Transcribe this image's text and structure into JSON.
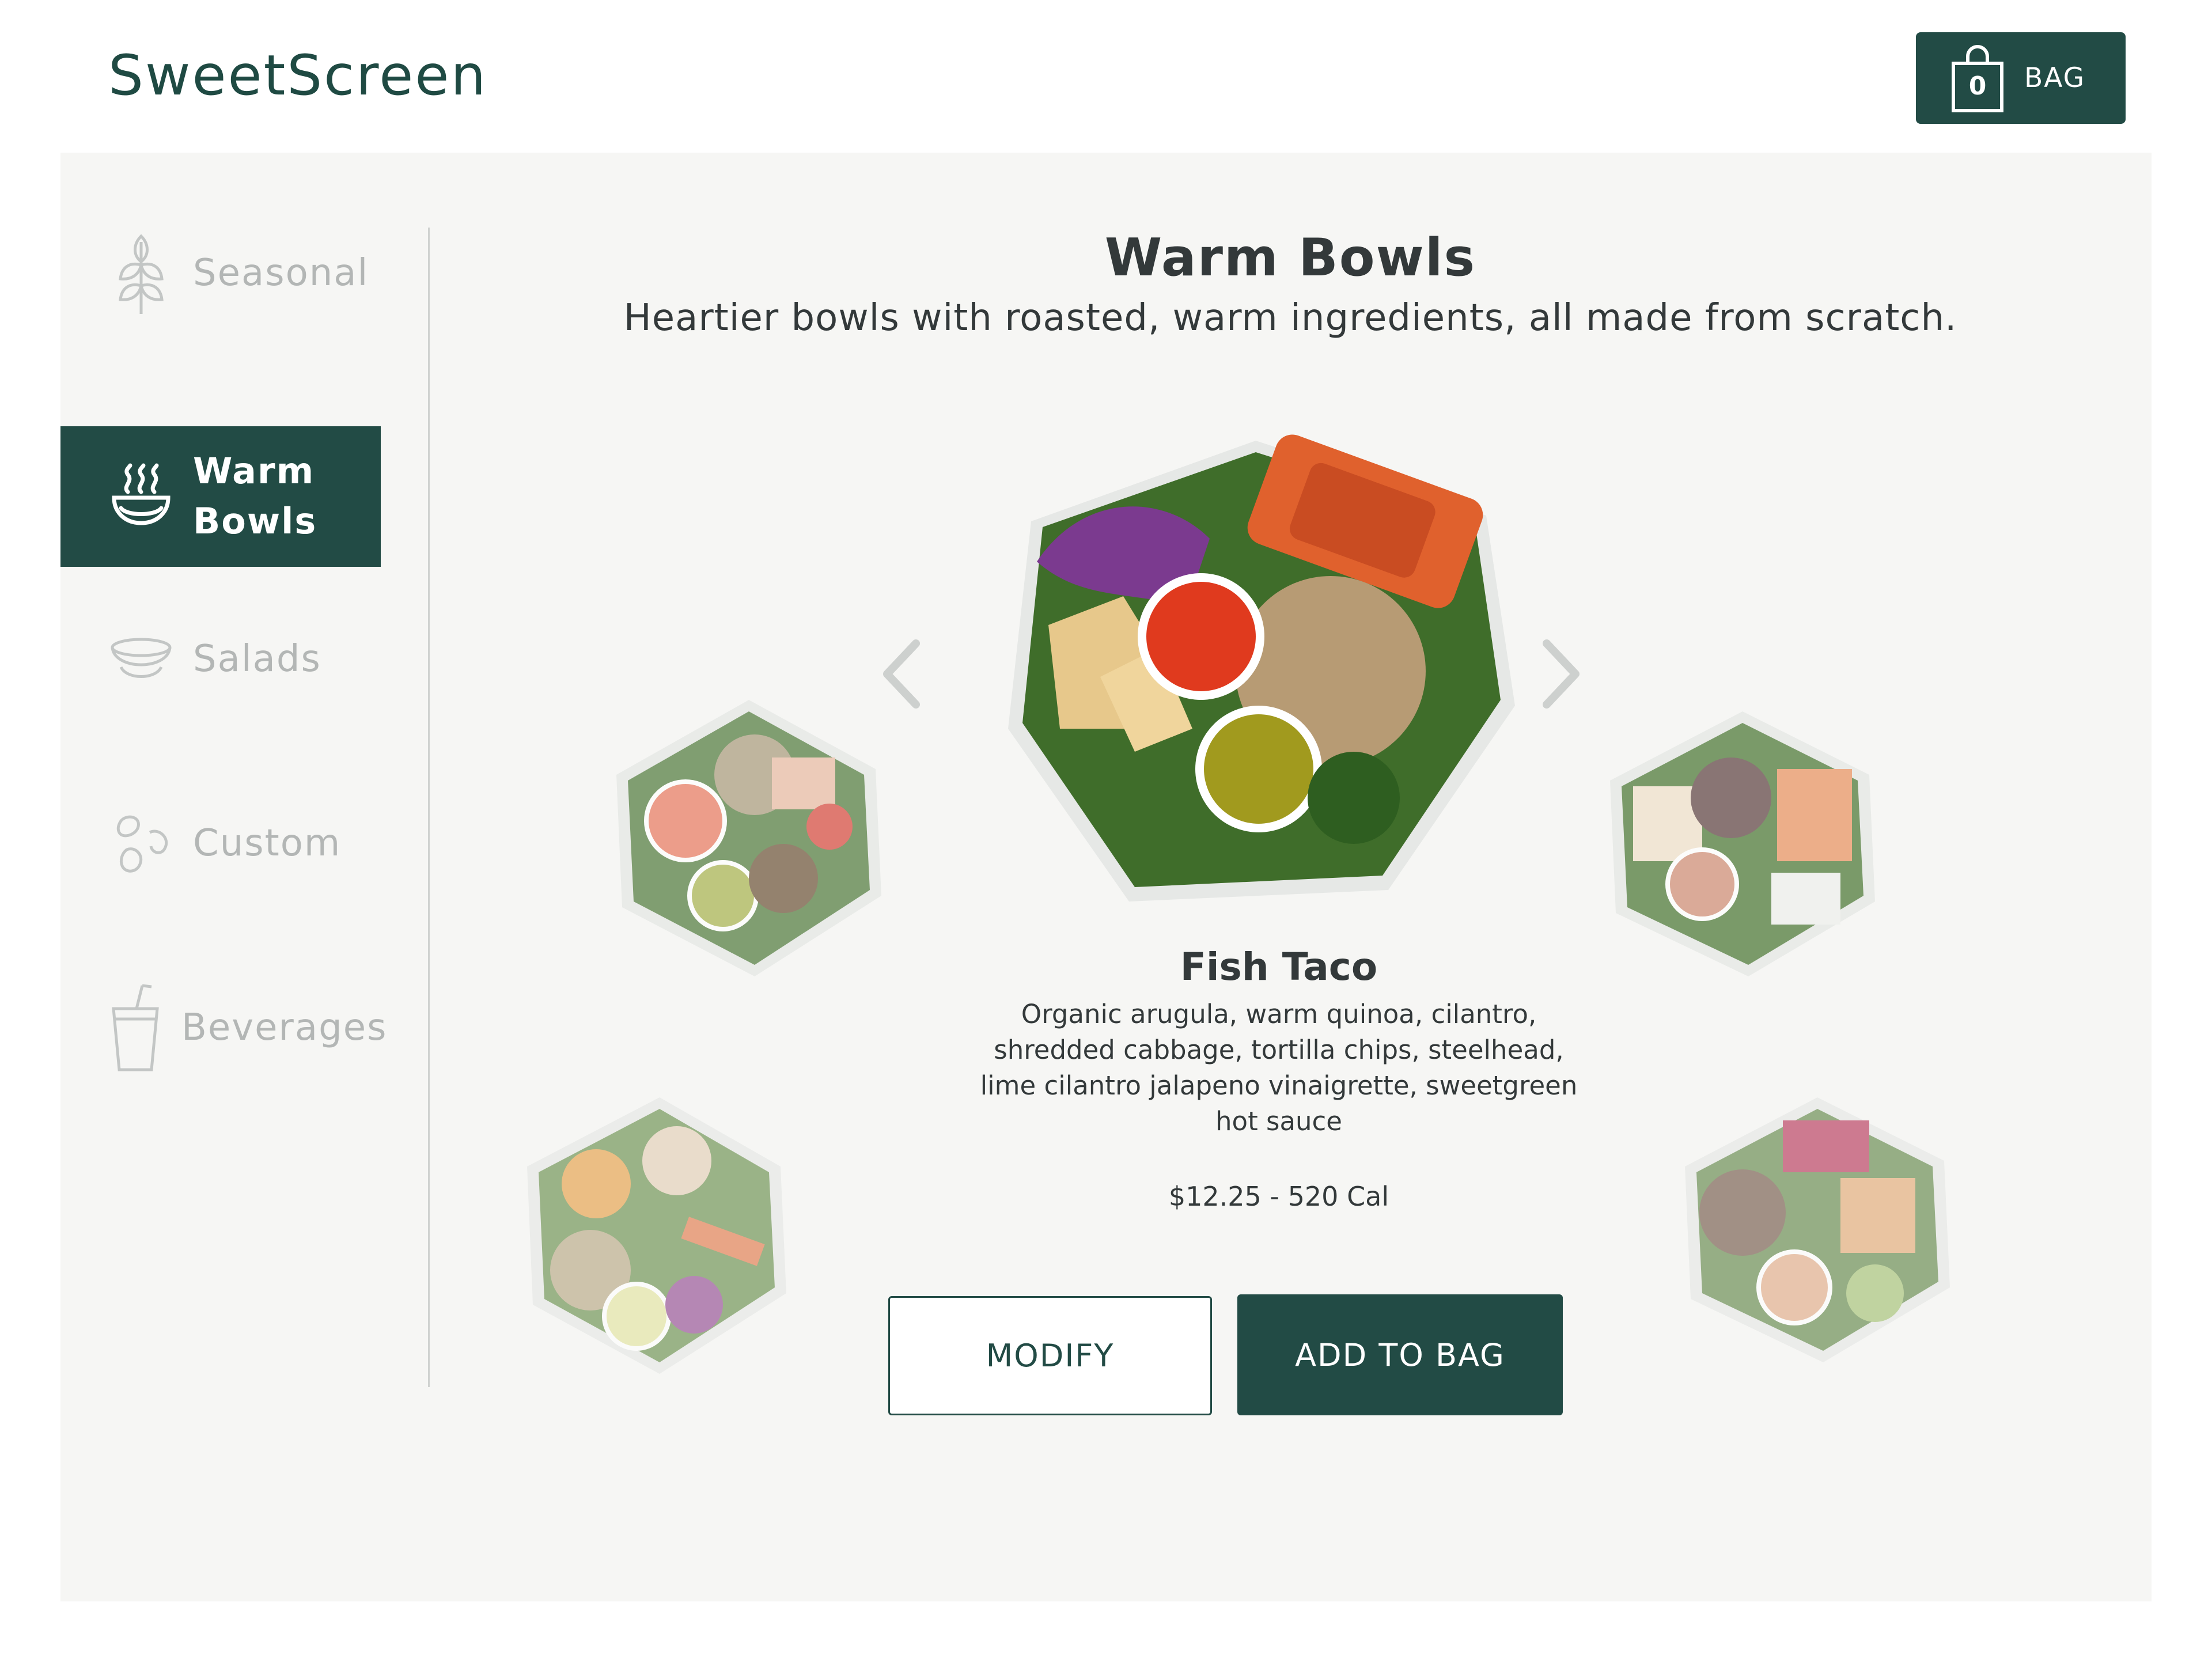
{
  "app": {
    "logo_text": "SweetScreen"
  },
  "header": {
    "bag_count": "0",
    "bag_label": "BAG",
    "bag_icon": "shopping-bag-icon"
  },
  "sidebar": {
    "items": [
      {
        "label": "Seasonal",
        "icon": "wheat-icon",
        "active": false
      },
      {
        "label": "Warm\nBowls",
        "icon": "steaming-bowl-icon",
        "active": true
      },
      {
        "label": "Salads",
        "icon": "salad-bowl-icon",
        "active": false
      },
      {
        "label": "Custom",
        "icon": "ingredients-icon",
        "active": false
      },
      {
        "label": "Beverages",
        "icon": "drink-cup-icon",
        "active": false
      }
    ]
  },
  "main": {
    "title": "Warm Bowls",
    "subtitle": "Heartier bowls with roasted, warm ingredients, all made from scratch.",
    "featured": {
      "name": "Fish Taco",
      "description": "Organic arugula, warm quinoa, cilantro, shredded cabbage, tortilla chips, steelhead, lime cilantro jalapeno vinaigrette, sweetgreen hot sauce",
      "price_cal": "$12.25 - 520 Cal"
    },
    "buttons": {
      "modify": "MODIFY",
      "add_to_bag": "ADD TO BAG"
    }
  },
  "colors": {
    "brand": "#224b45",
    "stage_bg": "#f6f6f4",
    "text": "#33393a",
    "muted": "#b3b6b5"
  }
}
